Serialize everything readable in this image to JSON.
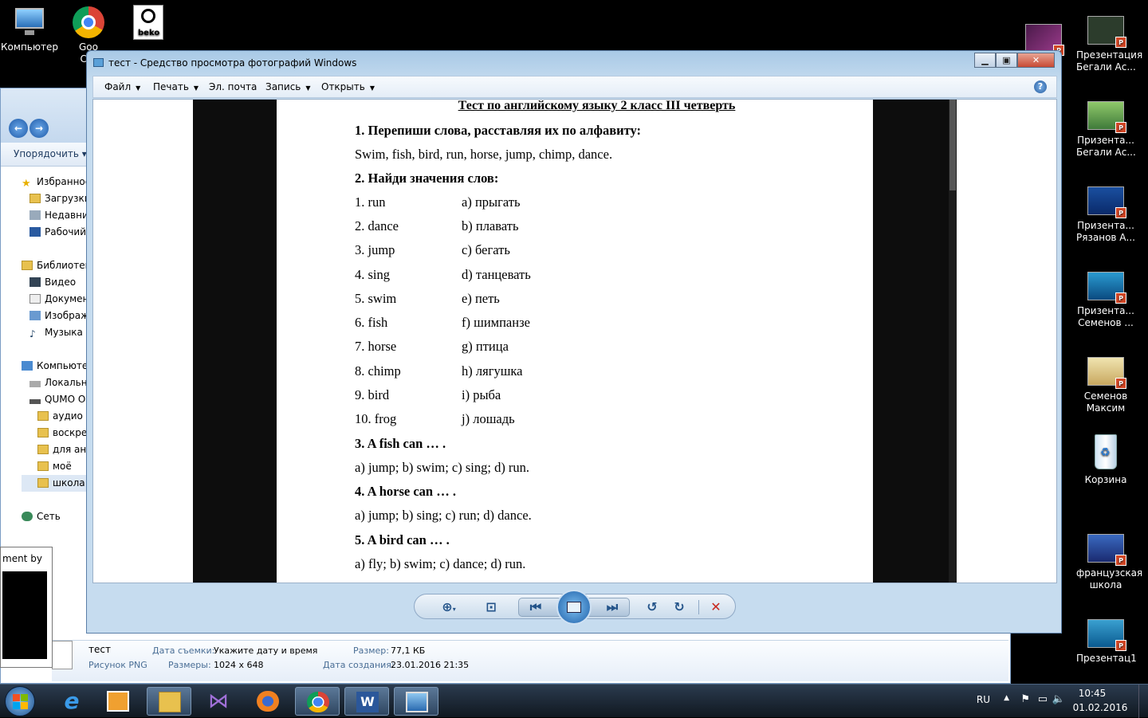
{
  "desktop": {
    "icons_left": [
      {
        "label": "Компьютер",
        "icon": "computer-icon"
      },
      {
        "label": "Goo\nChr",
        "icon": "chrome-icon"
      },
      {
        "label": "",
        "icon": "beko-icon"
      }
    ],
    "icons_right": [
      {
        "label": "Презентация\nБегали Ас..."
      },
      {
        "label": "Призента...\nБегали Ас..."
      },
      {
        "label": "Призента...\nРязанов А..."
      },
      {
        "label": "Призента...\nСеменов ..."
      },
      {
        "label": "Семенов\nМаксим"
      },
      {
        "label": "Корзина"
      },
      {
        "label": "французская\nшкола"
      },
      {
        "label": "Презентац1"
      }
    ]
  },
  "explorer": {
    "organize": "Упорядочить",
    "tree": [
      {
        "label": "Избранное",
        "icon": "star-icon"
      },
      {
        "label": "Загрузки",
        "icon": "folder-icon"
      },
      {
        "label": "Недавни",
        "icon": "recent-icon"
      },
      {
        "label": "Рабочий",
        "icon": "desktop-icon"
      },
      {
        "label": "",
        "icon": ""
      },
      {
        "label": "Библиотек",
        "icon": "library-icon"
      },
      {
        "label": "Видео",
        "icon": "video-icon"
      },
      {
        "label": "Докумен",
        "icon": "document-icon"
      },
      {
        "label": "Изображ",
        "icon": "image-icon"
      },
      {
        "label": "Музыка",
        "icon": "music-icon"
      },
      {
        "label": "",
        "icon": ""
      },
      {
        "label": "Компьютер",
        "icon": "computer-icon"
      },
      {
        "label": "Локальн",
        "icon": "drive-icon"
      },
      {
        "label": "QUMO O",
        "icon": "drive-icon"
      },
      {
        "label": "аудио а",
        "icon": "folder-icon"
      },
      {
        "label": "воскре",
        "icon": "folder-icon"
      },
      {
        "label": "для анг",
        "icon": "folder-icon"
      },
      {
        "label": "моё",
        "icon": "folder-icon"
      },
      {
        "label": "школа",
        "icon": "folder-icon"
      },
      {
        "label": "",
        "icon": ""
      },
      {
        "label": "Сеть",
        "icon": "network-icon"
      }
    ],
    "status": {
      "name": "тест",
      "type": "Рисунок PNG",
      "date_taken_label": "Дата съемки:",
      "date_taken_value": "Укажите дату и время",
      "dims_label": "Размеры:",
      "dims_value": "1024 x 648",
      "size_label": "Размер:",
      "size_value": "77,1 КБ",
      "created_label": "Дата создания:",
      "created_value": "23.01.2016 21:35"
    }
  },
  "viewer": {
    "title": "тест - Средство просмотра фотографий Windows",
    "menu": [
      {
        "label": "Файл",
        "arrow": true
      },
      {
        "label": "Печать",
        "arrow": true
      },
      {
        "label": "Эл. почта",
        "arrow": false
      },
      {
        "label": "Запись",
        "arrow": true
      },
      {
        "label": "Открыть",
        "arrow": true
      }
    ],
    "help": "?",
    "doc": {
      "title": "Тест по английскому языку 2 класс III четверть",
      "task1": "1. Перепиши слова, расставляя их по алфавиту:",
      "task1_words": "Swim, fish, bird, run, horse, jump, chimp, dance.",
      "task2": "2. Найди значения слов:",
      "pairs": [
        {
          "en": "1. run",
          "ru": "a) прыгать"
        },
        {
          "en": "2. dance",
          "ru": "b) плавать"
        },
        {
          "en": "3. jump",
          "ru": "c) бегать"
        },
        {
          "en": "4. sing",
          "ru": "d) танцевать"
        },
        {
          "en": "5. swim",
          "ru": "e) петь"
        },
        {
          "en": "6. fish",
          "ru": "f) шимпанзе"
        },
        {
          "en": "7. horse",
          "ru": "g) птица"
        },
        {
          "en": "8. chimp",
          "ru": "h) лягушка"
        },
        {
          "en": "9. bird",
          "ru": "i) рыба"
        },
        {
          "en": "10. frog",
          "ru": "j) лошадь"
        }
      ],
      "task3": "3.  A fish can … .",
      "task3_opts": "a) jump; b) swim; c) sing; d) run.",
      "task4": "4. A horse can … .",
      "task4_opts": "a) jump; b) sing; c) run; d) dance.",
      "task5": "5. A bird can … .",
      "task5_opts": "a) fly; b) swim; c) dance; d) run."
    }
  },
  "small_window": {
    "caption": "ment by ..."
  },
  "tray": {
    "lang": "RU",
    "time": "10:45",
    "date": "01.02.2016"
  },
  "colors": {
    "accent": "#1d5fa8",
    "close": "#c74a34"
  }
}
